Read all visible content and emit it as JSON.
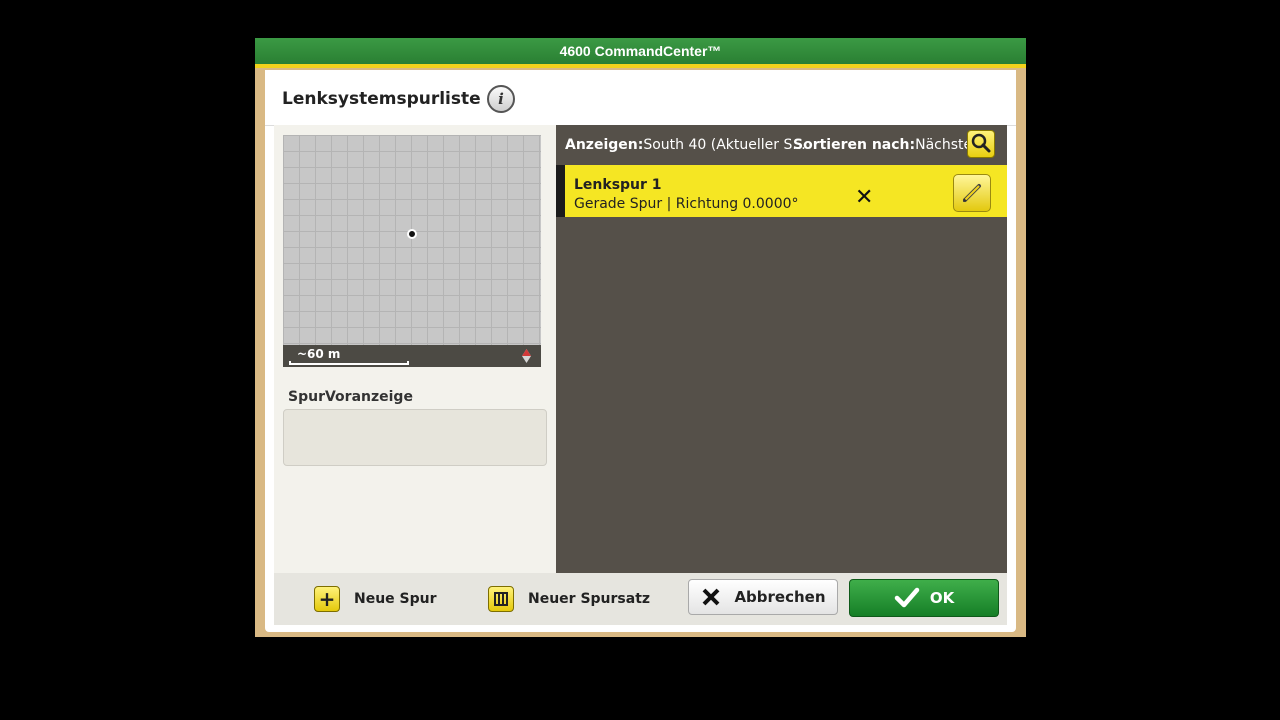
{
  "window": {
    "title": "4600 CommandCenter™"
  },
  "dialog": {
    "title": "Lenksystemspurliste",
    "info_icon": "info-icon"
  },
  "map": {
    "scale_label": "~60 m",
    "compass_icon": "compass-icon"
  },
  "preview": {
    "label": "SpurVoranzeige"
  },
  "filter": {
    "show_label": "Anzeigen:",
    "show_value": "South 40 (Aktueller S...",
    "sort_label": "Sortieren nach:",
    "sort_value": "Nächste"
  },
  "tracks": [
    {
      "name": "Lenkspur 1",
      "detail": "Gerade Spur | Richtung 0.0000°"
    }
  ],
  "footer": {
    "new_track": "Neue Spur",
    "new_track_set": "Neuer Spursatz",
    "cancel": "Abbrechen",
    "ok": "OK"
  },
  "colors": {
    "title_green": "#2a7f33",
    "accent_yellow": "#f5e623",
    "list_bg": "#555049",
    "ok_green": "#1f8f2f"
  }
}
